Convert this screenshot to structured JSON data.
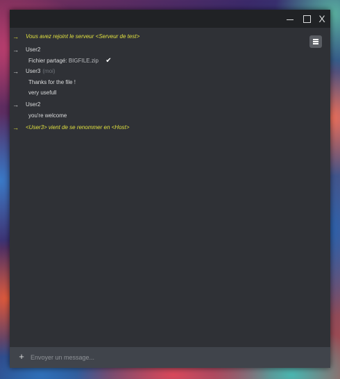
{
  "window_controls": {
    "close_label": "X"
  },
  "messages": [
    {
      "type": "system",
      "arrow": "→",
      "text": "Vous avez rejoint le serveur <Serveur de test>"
    },
    {
      "type": "user",
      "arrow": "→",
      "author": "User2",
      "lines": [
        {
          "kind": "file",
          "label": "Fichier partagé:",
          "file": "BIGFILE.zip",
          "status": "✔"
        }
      ]
    },
    {
      "type": "user",
      "arrow": "→",
      "author": "User3",
      "tag": "(moi)",
      "lines": [
        {
          "kind": "text",
          "text": "Thanks for the file !"
        },
        {
          "kind": "text",
          "text": "very usefull"
        }
      ]
    },
    {
      "type": "user",
      "arrow": "→",
      "author": "User2",
      "lines": [
        {
          "kind": "text",
          "text": "you're welcome"
        }
      ]
    },
    {
      "type": "system",
      "arrow": "→",
      "text": "<User3> vient de se renommer en <Host>"
    }
  ],
  "composer": {
    "add_label": "+",
    "placeholder": "Envoyer un message..."
  },
  "colors": {
    "window_bg": "#2f3136",
    "titlebar_bg": "#202225",
    "system_text": "#e0e040",
    "user_text": "#dcddde",
    "composer_bg": "#40444b"
  }
}
